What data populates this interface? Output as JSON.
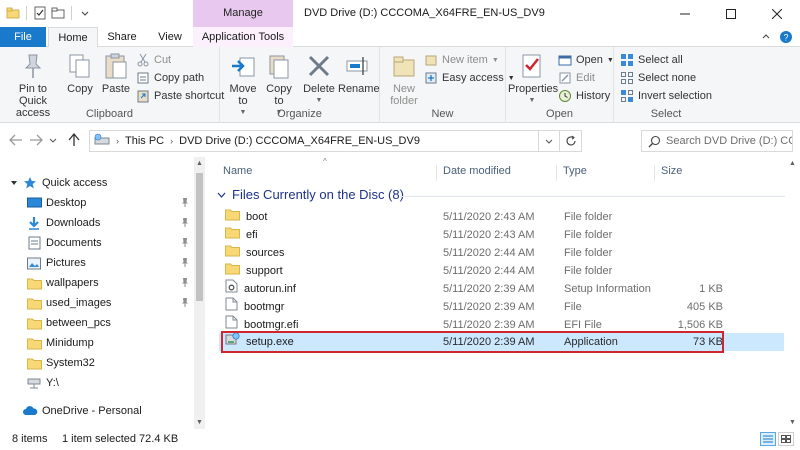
{
  "window": {
    "title": "DVD Drive (D:) CCCOMA_X64FRE_EN-US_DV9",
    "contextual_tab_group": "Manage"
  },
  "tabs": [
    {
      "label": "File",
      "active": false
    },
    {
      "label": "Home",
      "active": true
    },
    {
      "label": "Share",
      "active": false
    },
    {
      "label": "View",
      "active": false
    },
    {
      "label": "Application Tools",
      "active": false
    }
  ],
  "ribbon": {
    "clipboard": {
      "label": "Clipboard",
      "pin": "Pin to Quick access",
      "copy": "Copy",
      "paste": "Paste",
      "cut": "Cut",
      "copy_path": "Copy path",
      "paste_shortcut": "Paste shortcut"
    },
    "organize": {
      "label": "Organize",
      "move_to": "Move to",
      "copy_to": "Copy to",
      "delete": "Delete",
      "rename": "Rename"
    },
    "new": {
      "label": "New",
      "new_folder": "New folder",
      "new_item": "New item",
      "easy_access": "Easy access"
    },
    "open": {
      "label": "Open",
      "properties": "Properties",
      "open": "Open",
      "edit": "Edit",
      "history": "History"
    },
    "select": {
      "label": "Select",
      "select_all": "Select all",
      "select_none": "Select none",
      "invert_selection": "Invert selection"
    }
  },
  "address": {
    "crumbs": [
      "This PC",
      "DVD Drive (D:) CCCOMA_X64FRE_EN-US_DV9"
    ],
    "search_placeholder": "Search DVD Drive (D:) CC..."
  },
  "nav": {
    "quick_access": "Quick access",
    "items": [
      {
        "label": "Desktop",
        "icon": "desktop-icon",
        "pinned": true
      },
      {
        "label": "Downloads",
        "icon": "downloads-icon",
        "pinned": true
      },
      {
        "label": "Documents",
        "icon": "documents-icon",
        "pinned": true
      },
      {
        "label": "Pictures",
        "icon": "pictures-icon",
        "pinned": true
      },
      {
        "label": "wallpapers",
        "icon": "folder-icon",
        "pinned": true
      },
      {
        "label": "used_images",
        "icon": "folder-icon",
        "pinned": true
      },
      {
        "label": "between_pcs",
        "icon": "folder-icon",
        "pinned": false
      },
      {
        "label": "Minidump",
        "icon": "folder-icon",
        "pinned": false
      },
      {
        "label": "System32",
        "icon": "folder-icon",
        "pinned": false
      },
      {
        "label": "Y:\\",
        "icon": "network-drive-icon",
        "pinned": false
      }
    ],
    "onedrive": "OneDrive - Personal"
  },
  "columns": {
    "name": "Name",
    "date": "Date modified",
    "type": "Type",
    "size": "Size"
  },
  "group_header": "Files Currently on the Disc (8)",
  "files": [
    {
      "name": "boot",
      "date": "5/11/2020 2:43 AM",
      "type": "File folder",
      "size": "",
      "icon": "folder-icon"
    },
    {
      "name": "efi",
      "date": "5/11/2020 2:43 AM",
      "type": "File folder",
      "size": "",
      "icon": "folder-icon"
    },
    {
      "name": "sources",
      "date": "5/11/2020 2:44 AM",
      "type": "File folder",
      "size": "",
      "icon": "folder-icon"
    },
    {
      "name": "support",
      "date": "5/11/2020 2:44 AM",
      "type": "File folder",
      "size": "",
      "icon": "folder-icon"
    },
    {
      "name": "autorun.inf",
      "date": "5/11/2020 2:39 AM",
      "type": "Setup Information",
      "size": "1 KB",
      "icon": "settings-file-icon"
    },
    {
      "name": "bootmgr",
      "date": "5/11/2020 2:39 AM",
      "type": "File",
      "size": "405 KB",
      "icon": "file-icon"
    },
    {
      "name": "bootmgr.efi",
      "date": "5/11/2020 2:39 AM",
      "type": "EFI File",
      "size": "1,506 KB",
      "icon": "file-icon"
    },
    {
      "name": "setup.exe",
      "date": "5/11/2020 2:39 AM",
      "type": "Application",
      "size": "73 KB",
      "icon": "setup-app-icon"
    }
  ],
  "status": {
    "count": "8 items",
    "selection": "1 item selected  72.4 KB"
  },
  "colors": {
    "accent": "#1979ca",
    "manage_tab": "#e8c8ee",
    "selection": "#cce8ff",
    "highlight_border": "#d0262f",
    "folder": "#f8d775"
  }
}
